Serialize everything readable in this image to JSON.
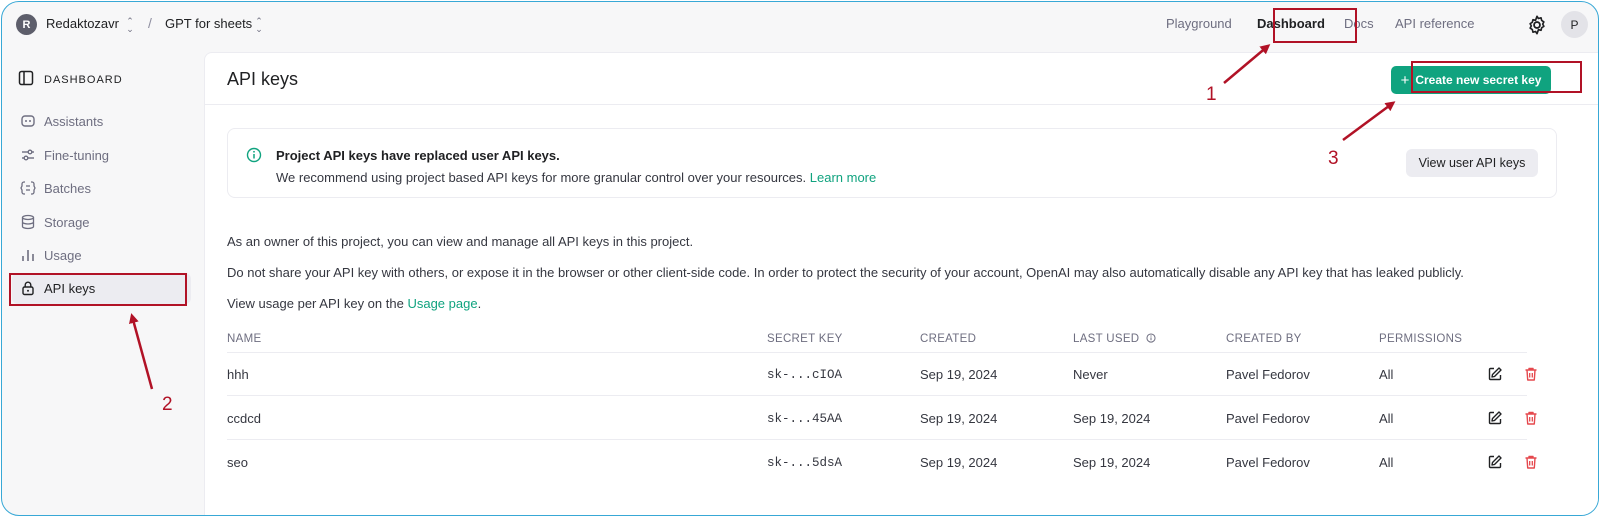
{
  "header": {
    "org_initial": "R",
    "org_name": "Redaktozavr",
    "project_name": "GPT for sheets",
    "nav": [
      "Playground",
      "Dashboard",
      "Docs",
      "API reference"
    ],
    "user_initial": "P"
  },
  "sidebar": {
    "section_label": "DASHBOARD",
    "items": [
      {
        "label": "Assistants",
        "icon": "robot-icon"
      },
      {
        "label": "Fine-tuning",
        "icon": "sliders-icon"
      },
      {
        "label": "Batches",
        "icon": "batches-icon"
      },
      {
        "label": "Storage",
        "icon": "database-icon"
      },
      {
        "label": "Usage",
        "icon": "bar-chart-icon"
      },
      {
        "label": "API keys",
        "icon": "lock-icon",
        "active": true
      }
    ]
  },
  "main": {
    "title": "API keys",
    "create_button": "Create new secret key",
    "notice": {
      "title": "Project API keys have replaced user API keys.",
      "body": "We recommend using project based API keys for more granular control over your resources.",
      "link": "Learn more",
      "button": "View user API keys"
    },
    "paragraphs": {
      "p1": "As an owner of this project, you can view and manage all API keys in this project.",
      "p2": "Do not share your API key with others, or expose it in the browser or other client-side code. In order to protect the security of your account, OpenAI may also automatically disable any API key that has leaked publicly.",
      "p3_prefix": "View usage per API key on the",
      "p3_link": "Usage page",
      "p3_suffix": "."
    },
    "table": {
      "columns": [
        "NAME",
        "SECRET KEY",
        "CREATED",
        "LAST USED",
        "CREATED BY",
        "PERMISSIONS"
      ],
      "rows": [
        {
          "name": "hhh",
          "key": "sk-...cIOA",
          "created": "Sep 19, 2024",
          "last_used": "Never",
          "created_by": "Pavel Fedorov",
          "permissions": "All"
        },
        {
          "name": "ccdcd",
          "key": "sk-...45AA",
          "created": "Sep 19, 2024",
          "last_used": "Sep 19, 2024",
          "created_by": "Pavel Fedorov",
          "permissions": "All"
        },
        {
          "name": "seo",
          "key": "sk-...5dsA",
          "created": "Sep 19, 2024",
          "last_used": "Sep 19, 2024",
          "created_by": "Pavel Fedorov",
          "permissions": "All"
        }
      ]
    }
  },
  "annotations": {
    "labels": [
      "1",
      "2",
      "3"
    ],
    "color": "#b11226"
  },
  "colors": {
    "accent": "#10a37f",
    "danger": "#e5484d"
  }
}
